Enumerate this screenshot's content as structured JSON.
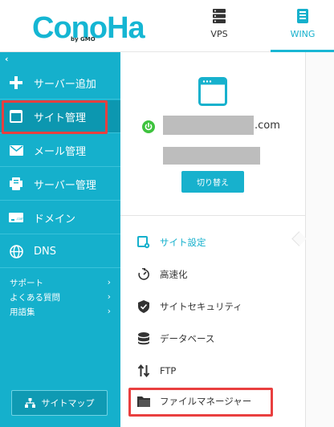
{
  "header": {
    "logo_text": "ConoHa",
    "logo_sub": "by GMO",
    "nav": [
      {
        "label": "VPS",
        "icon": "server-icon"
      },
      {
        "label": "WING",
        "icon": "wing-icon"
      }
    ]
  },
  "sidebar": {
    "collapse_glyph": "‹",
    "items": [
      {
        "label": "サーバー追加",
        "icon": "plus-icon"
      },
      {
        "label": "サイト管理",
        "icon": "window-icon"
      },
      {
        "label": "メール管理",
        "icon": "mail-icon"
      },
      {
        "label": "サーバー管理",
        "icon": "server-manage-icon"
      },
      {
        "label": "ドメイン",
        "icon": "domain-icon"
      },
      {
        "label": "DNS",
        "icon": "globe-icon"
      }
    ],
    "sublinks": [
      {
        "label": "サポート",
        "arrow": "›"
      },
      {
        "label": "よくある質問",
        "arrow": "›"
      },
      {
        "label": "用語集",
        "arrow": "›"
      }
    ],
    "sitemap_label": "サイトマップ"
  },
  "site": {
    "domain_suffix": ".com",
    "switch_label": "切り替え"
  },
  "menu": {
    "items": [
      {
        "label": "サイト設定",
        "icon": "site-settings-icon"
      },
      {
        "label": "高速化",
        "icon": "speed-icon"
      },
      {
        "label": "サイトセキュリティ",
        "icon": "shield-icon"
      },
      {
        "label": "データベース",
        "icon": "database-icon"
      },
      {
        "label": "FTP",
        "icon": "transfer-icon"
      },
      {
        "label": "ファイルマネージャー",
        "icon": "folder-icon"
      }
    ]
  },
  "colors": {
    "accent": "#15b0cc",
    "highlight": "#e93f3f"
  }
}
